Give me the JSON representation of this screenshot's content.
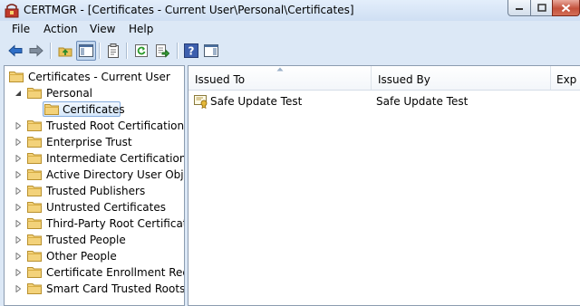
{
  "window": {
    "title": "CERTMGR - [Certificates - Current User\\Personal\\Certificates]"
  },
  "menu": [
    "File",
    "Action",
    "View",
    "Help"
  ],
  "toolbar": {
    "icons": [
      "back-arrow-icon",
      "forward-arrow-icon",
      "up-folder-icon",
      "show-hide-tree-icon",
      "properties-icon",
      "refresh-icon",
      "export-list-icon",
      "help-icon",
      "action-pane-icon"
    ]
  },
  "tree": {
    "root": "Certificates - Current User",
    "personal": "Personal",
    "selected": "Certificates",
    "items": [
      "Trusted Root Certification Au",
      "Enterprise Trust",
      "Intermediate Certification Au",
      "Active Directory User Object",
      "Trusted Publishers",
      "Untrusted Certificates",
      "Third-Party Root Certification",
      "Trusted People",
      "Other People",
      "Certificate Enrollment Reques",
      "Smart Card Trusted Roots"
    ]
  },
  "list": {
    "columns": [
      "Issued To",
      "Issued By",
      "Exp"
    ],
    "rows": [
      {
        "issued_to": "Safe Update Test",
        "issued_by": "Safe Update Test"
      }
    ]
  }
}
